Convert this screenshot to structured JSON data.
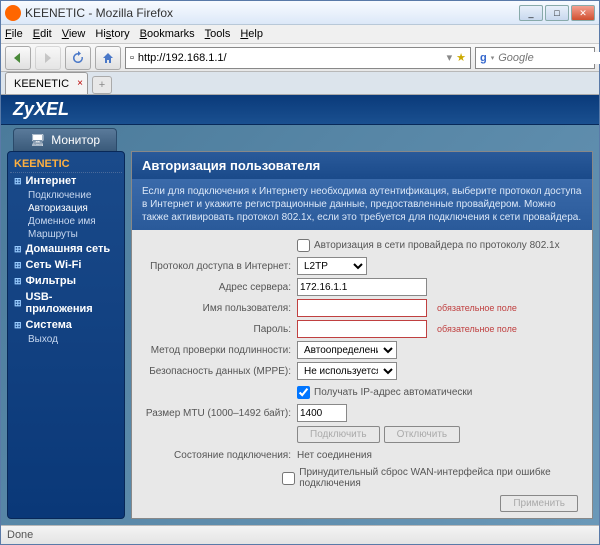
{
  "window": {
    "title": "KEENETIC - Mozilla Firefox"
  },
  "menu": {
    "file": "File",
    "edit": "Edit",
    "view": "View",
    "history": "History",
    "bookmarks": "Bookmarks",
    "tools": "Tools",
    "help": "Help"
  },
  "url": {
    "value": "http://192.168.1.1/"
  },
  "search": {
    "placeholder": "Google"
  },
  "tab": {
    "label": "KEENETIC"
  },
  "brand": "ZyXEL",
  "monitor": "Монитор",
  "sidebar": {
    "root": "KEENETIC",
    "groups": [
      {
        "label": "Интернет",
        "subs": [
          "Подключение",
          "Авторизация",
          "Доменное имя",
          "Маршруты"
        ]
      },
      {
        "label": "Домашняя сеть",
        "subs": []
      },
      {
        "label": "Сеть Wi-Fi",
        "subs": []
      },
      {
        "label": "Фильтры",
        "subs": []
      },
      {
        "label": "USB-приложения",
        "subs": []
      },
      {
        "label": "Система",
        "subs": [
          "Выход"
        ]
      }
    ]
  },
  "panel": {
    "title": "Авторизация пользователя",
    "help": "Если для подключения к Интернету необходима аутентификация, выберите протокол доступа в Интернет и укажите регистрационные данные, предоставленные провайдером. Можно также активировать протокол 802.1x, если это требуется для подключения к сети провайдера."
  },
  "form": {
    "auth8021x_label": "Авторизация в сети провайдера по протоколу 802.1x",
    "protocol_label": "Протокол доступа в Интернет:",
    "protocol_value": "L2TP",
    "server_label": "Адрес сервера:",
    "server_value": "172.16.1.1",
    "user_label": "Имя пользователя:",
    "user_value": "",
    "pass_label": "Пароль:",
    "pass_value": "",
    "required": "обязательное поле",
    "authmethod_label": "Метод проверки подлинности:",
    "authmethod_value": "Автоопределение",
    "mppe_label": "Безопасность данных (MPPE):",
    "mppe_value": "Не используется",
    "autoip_label": "Получать IP-адрес автоматически",
    "mtu_label": "Размер MTU (1000–1492 байт):",
    "mtu_value": "1400",
    "connect_btn": "Подключить",
    "disconnect_btn": "Отключить",
    "conn_state_label": "Состояние подключения:",
    "conn_state_value": "Нет соединения",
    "forcereset_label": "Принудительный сброс WAN-интерфейса при ошибке подключения",
    "apply_btn": "Применить"
  },
  "status": "Done"
}
